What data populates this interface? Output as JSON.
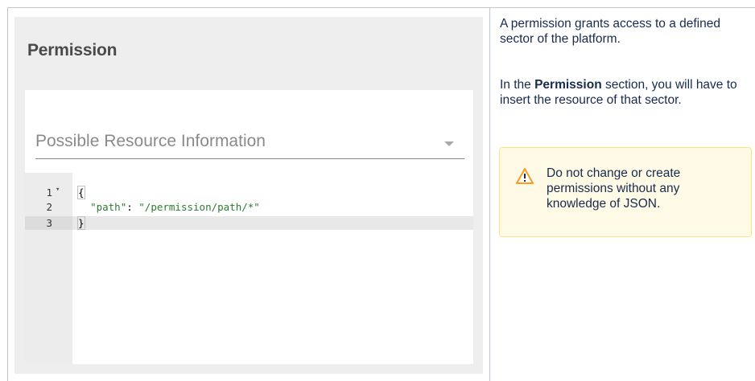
{
  "panel": {
    "title": "Permission",
    "select_label": "Possible Resource Information"
  },
  "editor": {
    "lines": [
      {
        "number": "1",
        "text": "{"
      },
      {
        "number": "2",
        "key": "\"path\"",
        "sep": ": ",
        "value": "\"/permission/path/*\""
      },
      {
        "number": "3",
        "text": "}"
      }
    ]
  },
  "description": {
    "p1": "A permission grants access to a defined sector of the platform.",
    "p2_pre": "In the ",
    "p2_bold": "Permission",
    "p2_post": " section, you will have to insert the resource of that sector."
  },
  "note": {
    "icon": "warning-icon",
    "text": "Do not change or create permissions without any knowledge of JSON."
  },
  "colors": {
    "panel_bg": "#eeeeee",
    "note_bg": "#fffae6",
    "note_border": "#ffe380",
    "string_green": "#2a7d2e"
  }
}
